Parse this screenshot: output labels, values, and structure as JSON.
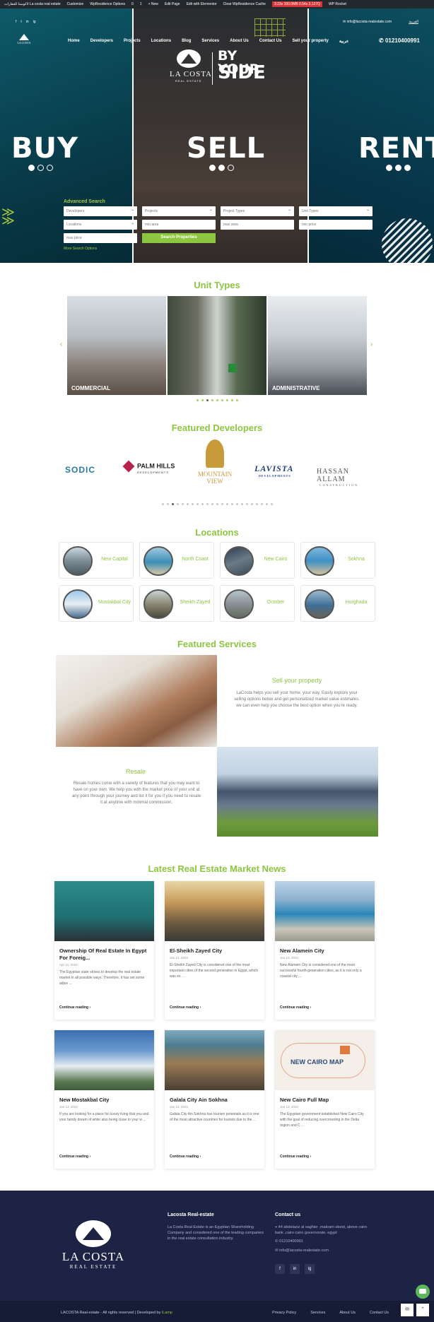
{
  "adminbar": {
    "items": [
      "لاكوستا للعقارات La costa real estate",
      "Customize",
      "WpResidence Options",
      "0",
      "1",
      "+ New",
      "Edit Page",
      "Edit with Elementor",
      "Clear WpResidence Cache"
    ],
    "perf": "3.23s 100.0MB 0.54s 2,127Q",
    "rocket": "WP Rocket"
  },
  "topbar": {
    "social": [
      "f",
      "t",
      "in",
      "ig"
    ],
    "email": "info@lacosta-realestate.com",
    "lang": "العربية"
  },
  "logo": {
    "name": "LA COSTA",
    "sub": "REAL ESTATE"
  },
  "nav": [
    "Home",
    "Developers",
    "Projects",
    "Locations",
    "Blog",
    "Services",
    "About Us",
    "Contact Us",
    "Sell your property",
    "عربية"
  ],
  "phone": "01210400991",
  "hero": {
    "tagline_1": "BY YOUR",
    "tagline_2": "SIDE",
    "panels": [
      "BUY",
      "SELL",
      "RENT"
    ]
  },
  "search": {
    "title": "Advanced Search",
    "row1": [
      "Developers",
      "Projects",
      "Project Types",
      "Unit Types"
    ],
    "row2": [
      "Locations",
      "min area",
      "max area",
      "min price"
    ],
    "row3_input": "max price",
    "button": "Search Properties",
    "more": "More Search Options"
  },
  "unit_types": {
    "heading": "Unit Types",
    "items": [
      "COMMERCIAL",
      "",
      "ADMINISTRATIVE"
    ],
    "pharmacy_sign": "PHARMACY"
  },
  "developers": {
    "heading": "Featured Developers",
    "items": [
      "SODIC",
      "PALM HILLS",
      "DEVELOPMENTS",
      "MOUNTAIN",
      "VIEW",
      "LAVISTA",
      "DEVELOPMENTS",
      "HASSAN ALLAM",
      "CONSTRUCTION"
    ]
  },
  "locations": {
    "heading": "Locations",
    "items": [
      "New Capital",
      "North Coast",
      "New Cairo",
      "Sokhna",
      "Mostakbal City",
      "Sheikh Zayed",
      "October",
      "Hurghada"
    ]
  },
  "services": {
    "heading": "Featured Services",
    "sell_title": "Sell your property",
    "sell_text": "LaCosta helps you sell your home, your way. Easily explore your selling options below and get personalized market value estimates. we can even help you choose the best option when you're ready.",
    "resale_title": "Resale",
    "resale_text": "Resale homes come with a variety of features that you may want to have on your own. We help you with the market price of your unit at any point through your journey and list it for you if you need to resale it at anytime with minimal commission."
  },
  "news": {
    "heading": "Latest Real Estate Market News",
    "more_label": "Continue reading",
    "cards": [
      {
        "title": "Ownership Of Real Estate In Egypt For Foreig...",
        "date": "Apr 21, 2022",
        "excerpt": "The Egyptian state strives to develop the real estate market in all possible ways. Therefore, it has set some adjus ..."
      },
      {
        "title": "El-Sheikh Zayed City",
        "date": "Jan 13, 2022",
        "excerpt": "El-Sheikh Zayed City is considered one of the most important cities of the second generation in Egypt, which was es ..."
      },
      {
        "title": "New Alamein City",
        "date": "Jan 13, 2022",
        "excerpt": "New Alamein City is considered one of the most successful fourth-generation cities, as it is not only a coastal city ..."
      },
      {
        "title": "New Mostakbal City",
        "date": "Jan 13, 2022",
        "excerpt": "If you are looking for a place for luxury living that you and your family dream of while also being close to your w ..."
      },
      {
        "title": "Galala City Ain Sokhna",
        "date": "Jan 13, 2022",
        "excerpt": "Galala City Ain Sokhna has tourism potentials as it is one of the most attractive countries for tourists due to the ..."
      },
      {
        "title": "New Cairo Full Map",
        "date": "Jan 13, 2022",
        "excerpt": "The Egyptian government established New Cairo City with the goal of reducing overcrowding in the Delta region and C ..."
      }
    ],
    "map_label": "NEW CAIRO MAP"
  },
  "footer": {
    "about_title": "Lacosta Real-estate",
    "about_text": "La Costa Real Estate is an Egyptian Shareholding Company and considered one of the leading companies in the real estate consultation industry.",
    "contact_title": "Contact us",
    "address": "44 abdelaziz al saghier ,makram ebeid, above cairo bank ,cairo cairo governorate, egypt",
    "phone": "01210400991",
    "email": "info@lacosta-realestate.com",
    "social": [
      "f",
      "in",
      "ig"
    ],
    "copyright": "LACOSTA Real-estate - All rights reserved | Developed by ",
    "developer": "iLamp",
    "links": [
      "Privacy Policy",
      "Services",
      "About Us",
      "Contact Us"
    ]
  },
  "colors": {
    "accent": "#8dc63f",
    "footer": "#1d2344",
    "hero_teal": "#0b4a5a"
  }
}
